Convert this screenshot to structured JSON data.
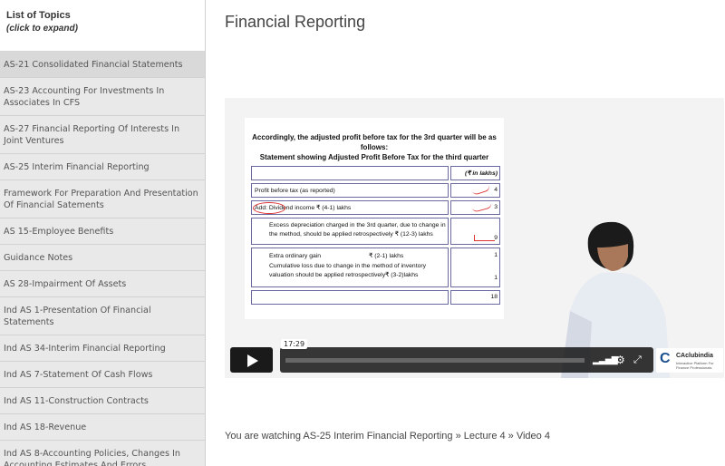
{
  "sidebar": {
    "header_title": "List of Topics",
    "header_subtitle": "(click to expand)",
    "items": [
      {
        "label": "AS-21 Consolidated Financial Statements"
      },
      {
        "label": "AS-23 Accounting For Investments In Associates In CFS"
      },
      {
        "label": "AS-27 Financial Reporting Of Interests In Joint Ventures"
      },
      {
        "label": "AS-25 Interim Financial Reporting"
      },
      {
        "label": "Framework For Preparation And Presentation Of Financial Satements"
      },
      {
        "label": "AS 15-Employee Benefits"
      },
      {
        "label": "Guidance Notes"
      },
      {
        "label": "AS 28-Impairment Of Assets"
      },
      {
        "label": "Ind AS 1-Presentation Of Financial Statements"
      },
      {
        "label": "Ind AS 34-Interim Financial Reporting"
      },
      {
        "label": "Ind AS 7-Statement Of Cash Flows"
      },
      {
        "label": "Ind AS 11-Construction Contracts"
      },
      {
        "label": "Ind AS 18-Revenue"
      },
      {
        "label": "Ind AS 8-Accounting Policies, Changes In Accounting Estimates And Errors"
      }
    ]
  },
  "main": {
    "title": "Financial Reporting",
    "watching_text": "You are watching AS-25 Interim Financial Reporting » Lecture 4 » Video 4"
  },
  "video": {
    "timecode": "17:29",
    "progress_fraction": 0.0,
    "slide": {
      "title_line1": "Accordingly, the adjusted profit before tax for the 3rd quarter will be as",
      "title_line2": "follows:",
      "title_line3": "Statement showing Adjusted Profit Before Tax for the third quarter",
      "unit_header": "(₹ in lakhs)",
      "row1_label": "Profit before tax (as reported)",
      "row1_value": "4",
      "row2_label": "Add: Dividend income ₹ (4-1) lakhs",
      "row2_value": "3",
      "row3_line1": "Excess depreciation charged in the 3rd quarter, due to change in",
      "row3_line2": "the method, should be applied retrospectively ₹ (12-3) lakhs",
      "row3_value": "9",
      "row4_label_a": "Extra ordinary gain",
      "row4_amount_a": "₹ (2-1) lakhs",
      "row4_value_a": "1",
      "row4_label_b1": "Cumulative loss due to change in the method of inventory",
      "row4_label_b2": "valuation should be applied retrospectively",
      "row4_amount_b": "₹ (3-2)lakhs",
      "row4_value_b": "1",
      "total_value": "18"
    },
    "logo": {
      "mark": "C",
      "name": "CAclubindia",
      "tagline": "Interactive Platform For Finance Professionals"
    },
    "icons": [
      "play-icon",
      "volume-icon",
      "settings-icon",
      "fullscreen-icon"
    ]
  }
}
